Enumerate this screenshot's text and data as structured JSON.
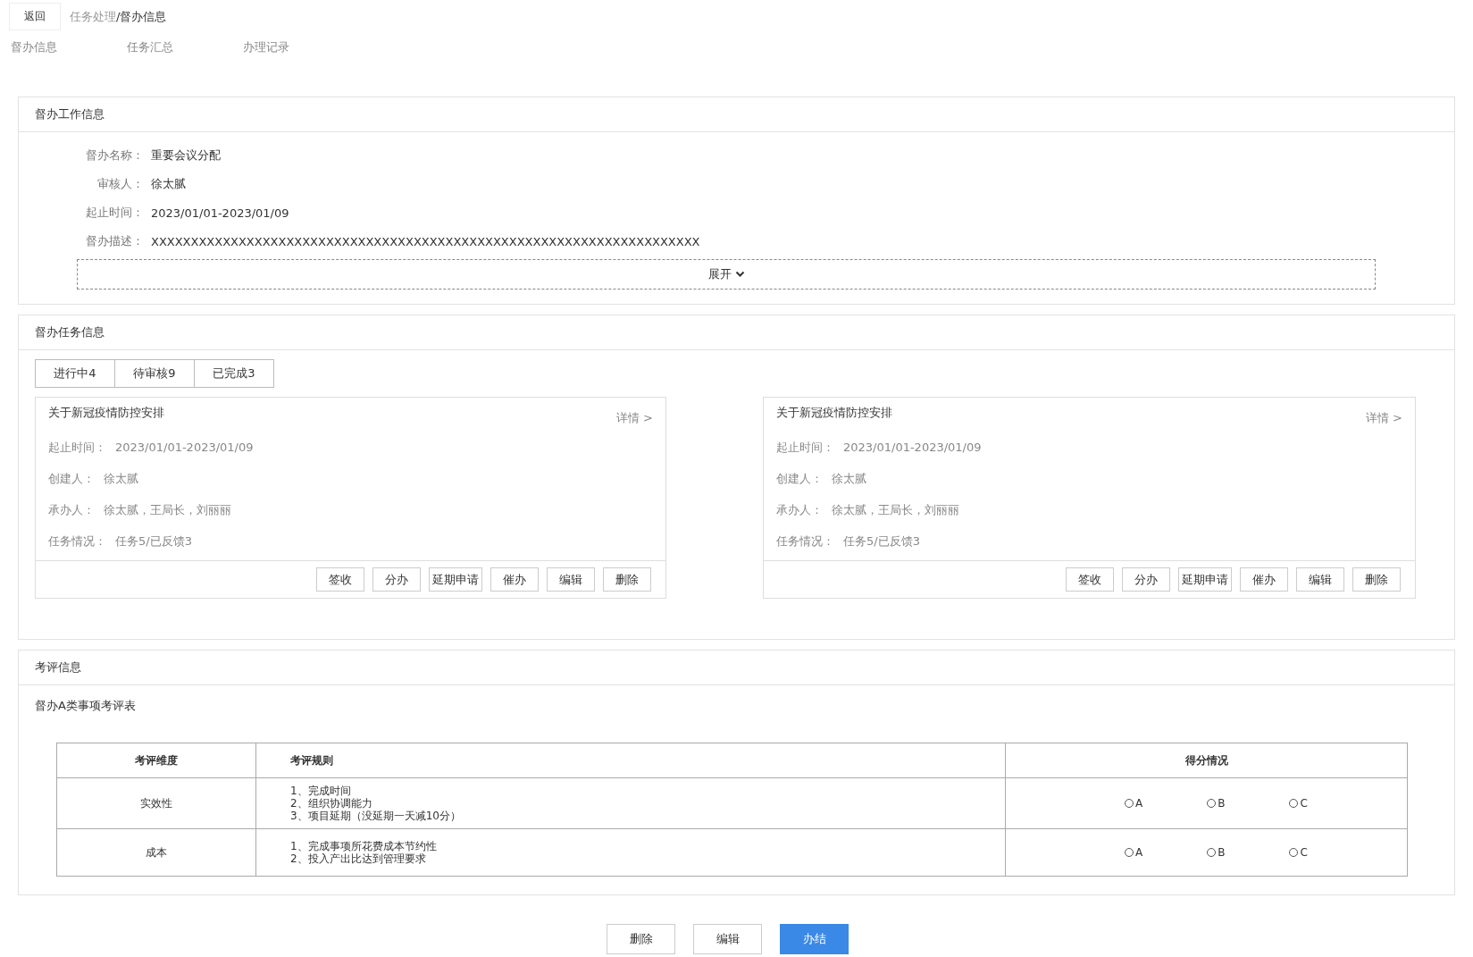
{
  "header": {
    "back_button": "返回",
    "breadcrumb": [
      {
        "label": "任务处理",
        "current": false
      },
      {
        "label": "/督办信息",
        "current": true
      }
    ]
  },
  "page_tabs": [
    {
      "label": "督办信息",
      "selected": false
    },
    {
      "label": "任务汇总",
      "selected": false
    },
    {
      "label": "办理记录",
      "selected": false
    }
  ],
  "work_info": {
    "title": "督办工作信息",
    "fields": [
      {
        "label": "督办名称：",
        "value": "重要会议分配"
      },
      {
        "label": "审核人：",
        "value": "徐太腻"
      },
      {
        "label": "起止时间：",
        "value": "2023/01/01-2023/01/09"
      },
      {
        "label": "督办描述：",
        "value": "XXXXXXXXXXXXXXXXXXXXXXXXXXXXXXXXXXXXXXXXXXXXXXXXXXXXXXXXXXXXXXXXXXXXX"
      }
    ],
    "expand_button": "展开"
  },
  "task_info": {
    "title": "督办任务信息",
    "tabs": [
      {
        "label": "进行中4",
        "selected": false
      },
      {
        "label": "待审核9",
        "selected": false
      },
      {
        "label": "已完成3",
        "selected": false
      }
    ],
    "cards": [
      {
        "title": "关于新冠疫情防控安排",
        "detail_link": "详情 >",
        "fields": [
          {
            "label": "起止时间：",
            "value": "2023/01/01-2023/01/09"
          },
          {
            "label": "创建人：",
            "value": "徐太腻"
          },
          {
            "label": "承办人：",
            "value": "徐太腻，王局长，刘丽丽"
          },
          {
            "label": "任务情况：",
            "value": "任务5/已反馈3"
          }
        ],
        "buttons": [
          "签收",
          "分办",
          "延期申请",
          "催办",
          "编辑",
          "删除"
        ]
      },
      {
        "title": "关于新冠疫情防控安排",
        "detail_link": "详情 >",
        "fields": [
          {
            "label": "起止时间：",
            "value": "2023/01/01-2023/01/09"
          },
          {
            "label": "创建人：",
            "value": "徐太腻"
          },
          {
            "label": "承办人：",
            "value": "徐太腻，王局长，刘丽丽"
          },
          {
            "label": "任务情况：",
            "value": "任务5/已反馈3"
          }
        ],
        "buttons": [
          "签收",
          "分办",
          "延期申请",
          "催办",
          "编辑",
          "删除"
        ]
      }
    ]
  },
  "evaluation": {
    "title": "考评信息",
    "table_title": "督办A类事项考评表",
    "columns": [
      "考评维度",
      "考评规则",
      "得分情况"
    ],
    "rows": [
      {
        "dimension": "实效性",
        "rules": [
          "1、完成时间",
          "2、组织协调能力",
          "3、项目延期（没延期一天减10分）"
        ],
        "options": [
          {
            "label": "A",
            "selected": false
          },
          {
            "label": "B",
            "selected": false
          },
          {
            "label": "C",
            "selected": false
          }
        ]
      },
      {
        "dimension": "成本",
        "rules": [
          "1、完成事项所花费成本节约性",
          "2、投入产出比达到管理要求"
        ],
        "options": [
          {
            "label": "A",
            "selected": false
          },
          {
            "label": "B",
            "selected": false
          },
          {
            "label": "C",
            "selected": false
          }
        ]
      }
    ]
  },
  "footer_buttons": [
    {
      "label": "删除",
      "kind": "default"
    },
    {
      "label": "编辑",
      "kind": "default"
    },
    {
      "label": "办结",
      "kind": "primary"
    }
  ]
}
